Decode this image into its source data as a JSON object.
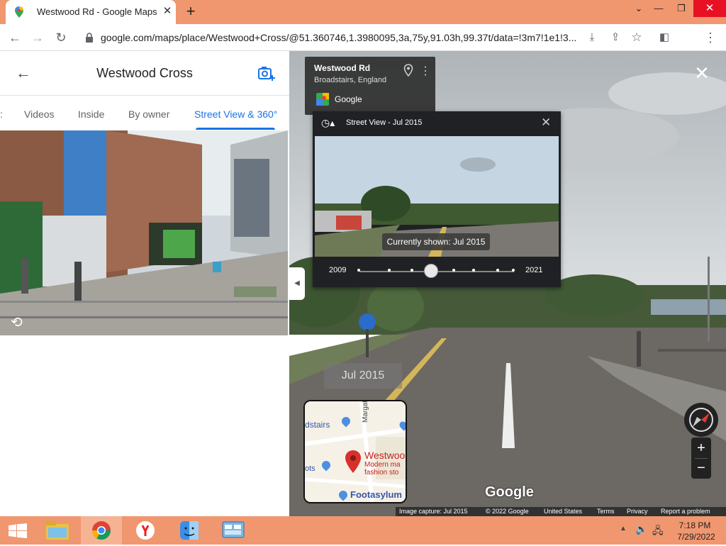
{
  "browser": {
    "tab_title": "Westwood Rd - Google Maps",
    "url": "google.com/maps/place/Westwood+Cross/@51.360746,1.3980095,3a,75y,91.03h,99.37t/data=!3m7!1e1!3..."
  },
  "left_panel": {
    "title": "Westwood Cross",
    "tabs": [
      {
        "label": "Videos"
      },
      {
        "label": "Inside"
      },
      {
        "label": "By owner"
      },
      {
        "label": "Street View & 360°"
      }
    ]
  },
  "street_view": {
    "road_name": "Westwood Rd",
    "location": "Broadstairs, England",
    "provider": "Google",
    "time_machine": {
      "header": "Street View - Jul 2015",
      "tooltip": "Currently shown: Jul 2015",
      "year_start": "2009",
      "year_end": "2021"
    },
    "date_overlay": "Jul 2015",
    "watermark": "Google",
    "minimap": {
      "label_broadstairs": "dstairs",
      "label_margate": "Margate",
      "label_place": "Westwoo",
      "label_desc1": "Modern ma",
      "label_desc2": "fashion sto",
      "label_ots": "ots",
      "label_shop": "Footasylum"
    },
    "footer": {
      "capture": "Image capture: Jul 2015",
      "copyright": "© 2022 Google",
      "country": "United States",
      "terms": "Terms",
      "privacy": "Privacy",
      "report": "Report a problem"
    }
  },
  "taskbar": {
    "time": "7:18 PM",
    "date": "7/29/2022"
  }
}
